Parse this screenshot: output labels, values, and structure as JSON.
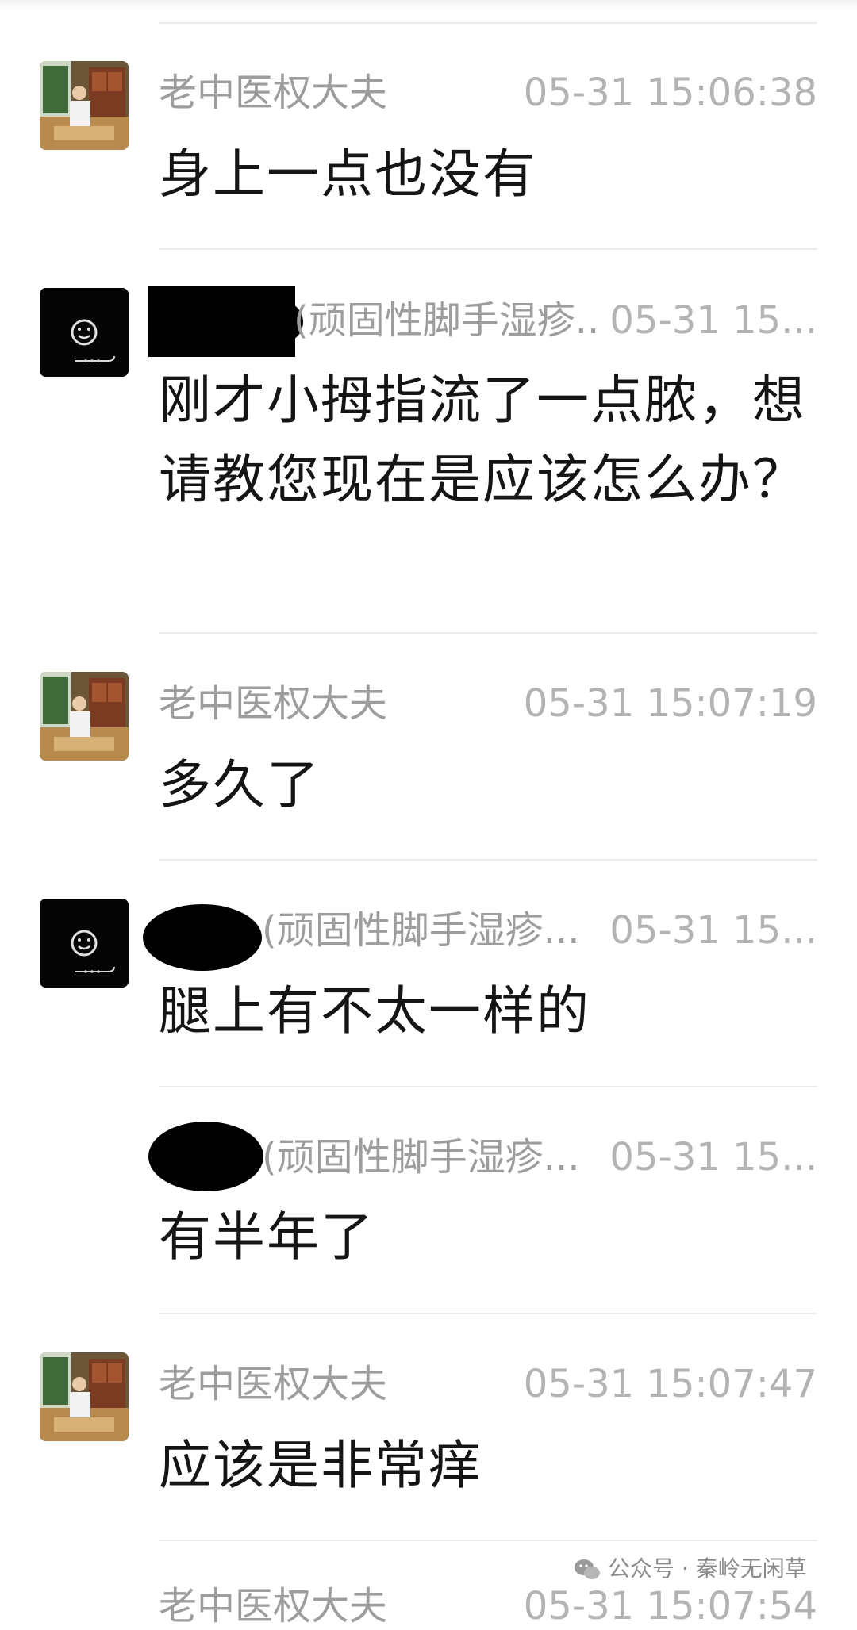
{
  "messages": [
    {
      "sender": "老中医权大夫",
      "time": "05-31 15:06:38",
      "text": "身上一点也没有"
    },
    {
      "sender": "(顽固性脚手湿疹...",
      "time": "05-31 15...",
      "text": "刚才小拇指流了一点脓，想请教您现在是应该怎么办？"
    },
    {
      "sender": "老中医权大夫",
      "time": "05-31 15:07:19",
      "text": "多久了"
    },
    {
      "sender": "(顽固性脚手湿疹...",
      "time": "05-31 15...",
      "text": "腿上有不太一样的"
    },
    {
      "sender": "(顽固性脚手湿疹...",
      "time": "05-31 15...",
      "text": "有半年了"
    },
    {
      "sender": "老中医权大夫",
      "time": "05-31 15:07:47",
      "text": "应该是非常痒"
    },
    {
      "sender": "老中医权大夫",
      "time": "05-31 15:07:54"
    }
  ],
  "watermark": {
    "text": "公众号 · 秦岭无闲草"
  },
  "icons": {
    "doctor_avatar": "doctor-photo-avatar-icon",
    "patient_avatar": "smiley-face-avatar-icon",
    "watermark_icon": "wechat-icon"
  }
}
